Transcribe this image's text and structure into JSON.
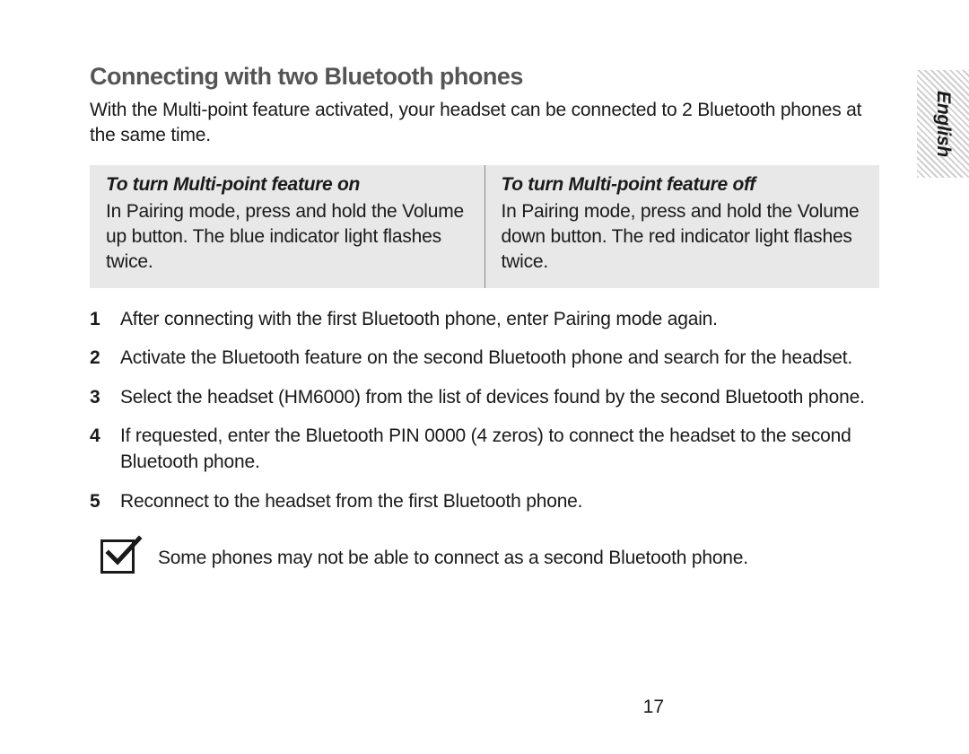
{
  "sideTab": {
    "label": "English"
  },
  "heading": "Connecting with two Bluetooth phones",
  "intro": "With the Multi-point feature activated, your headset can be connected to 2 Bluetooth phones at the same time.",
  "featureTable": {
    "left": {
      "header": "To turn Multi-point feature on",
      "body": "In Pairing mode, press and hold the Volume up button. The blue indicator light flashes twice."
    },
    "right": {
      "header": "To turn Multi-point feature off",
      "body": "In Pairing mode, press and hold the Volume down button. The red indicator light flashes twice."
    }
  },
  "steps": [
    {
      "num": "1",
      "text": "After connecting with the first Bluetooth phone, enter Pairing mode again."
    },
    {
      "num": "2",
      "text": "Activate the Bluetooth feature on the second Bluetooth phone and search for the headset."
    },
    {
      "num": "3",
      "text": "Select the headset (HM6000) from the list of devices found by the second Bluetooth phone."
    },
    {
      "num": "4",
      "text": "If requested, enter the Bluetooth PIN 0000 (4 zeros) to connect the headset to the second Bluetooth phone."
    },
    {
      "num": "5",
      "text": "Reconnect to the headset from the first Bluetooth phone."
    }
  ],
  "note": "Some phones may not be able to connect as a second Bluetooth phone.",
  "pageNumber": "17"
}
